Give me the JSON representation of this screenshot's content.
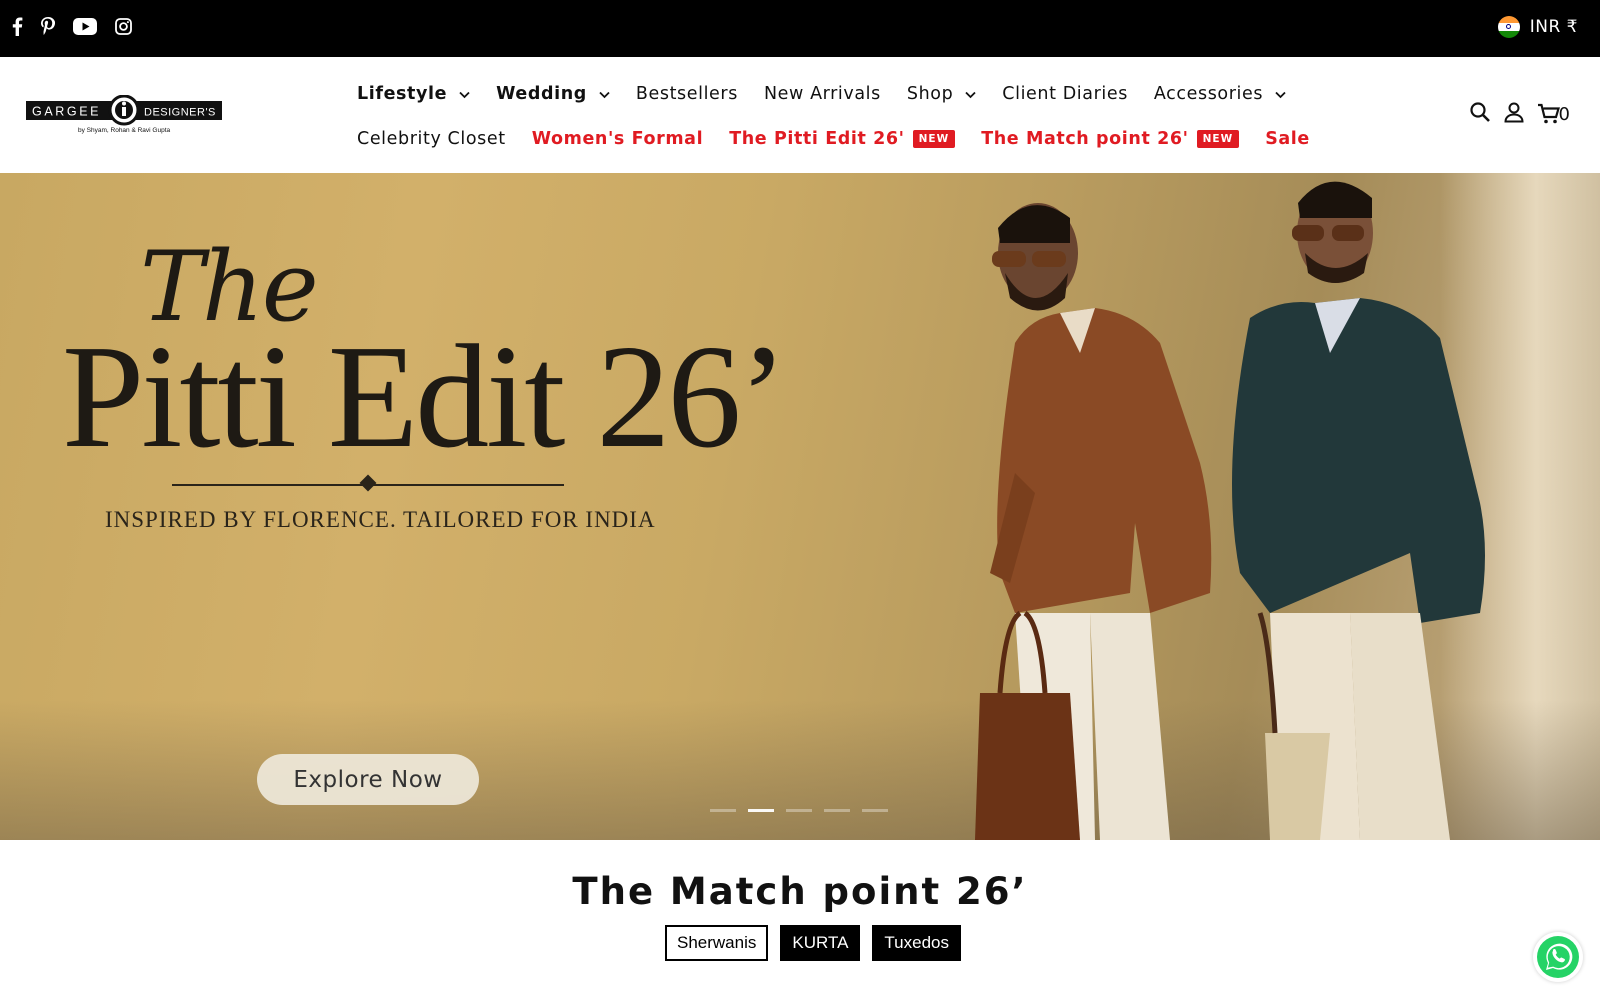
{
  "topbar": {
    "social_icons": [
      "facebook-icon",
      "pinterest-icon",
      "youtube-icon",
      "instagram-icon"
    ],
    "currency": "INR ₹",
    "flag": "india-flag-icon"
  },
  "header": {
    "logo": {
      "brand_left": "GARGEE",
      "brand_right": "DESIGNER'S",
      "tagline": "by Shyam, Rohan & Ravi Gupta"
    },
    "nav_row1": [
      {
        "label": "Lifestyle",
        "dropdown": true
      },
      {
        "label": "Wedding",
        "dropdown": true
      },
      {
        "label": "Bestsellers",
        "dropdown": false
      },
      {
        "label": "New Arrivals",
        "dropdown": false
      },
      {
        "label": "Shop",
        "dropdown": true
      },
      {
        "label": "Client Diaries",
        "dropdown": false
      },
      {
        "label": "Accessories",
        "dropdown": true
      }
    ],
    "nav_row2": [
      {
        "label": "Celebrity Closet"
      },
      {
        "label": "Women's Formal"
      },
      {
        "label": "The Pitti Edit 26'",
        "badge": "NEW"
      },
      {
        "label": "The Match point 26'",
        "badge": "NEW"
      },
      {
        "label": "Sale"
      }
    ],
    "cart_count": "0"
  },
  "hero": {
    "title_script": "The",
    "title": "Pitti Edit 26’",
    "subtitle": "INSPIRED BY FLORENCE. TAILORED FOR INDIA",
    "cta": "Explore Now",
    "slides_total": 5,
    "slide_active": 2
  },
  "section": {
    "title": "The Match point 26’",
    "tabs": [
      {
        "label": "Sherwanis",
        "active": true
      },
      {
        "label": "KURTA",
        "active": false
      },
      {
        "label": "Tuxedos",
        "active": false
      }
    ]
  },
  "colors": {
    "topbar": "#000000",
    "accent_red": "#e01b22",
    "whatsapp": "#25d366"
  }
}
